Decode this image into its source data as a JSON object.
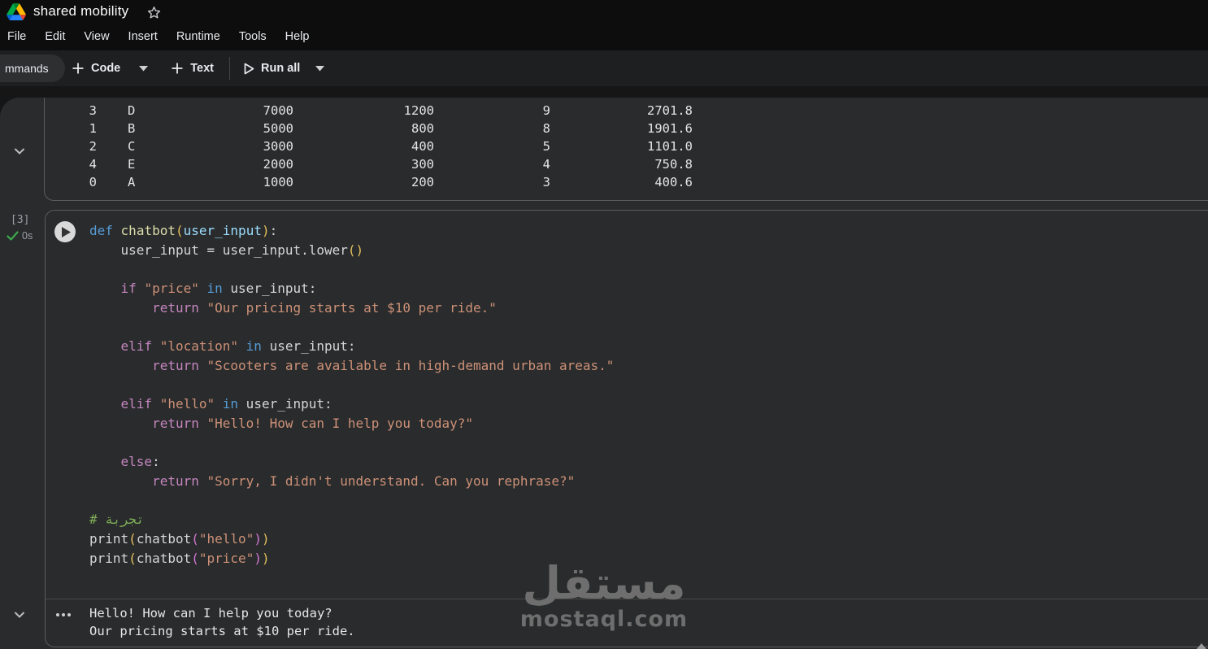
{
  "titlebar": {
    "title": "shared mobility"
  },
  "menubar": {
    "items": [
      "File",
      "Edit",
      "View",
      "Insert",
      "Runtime",
      "Tools",
      "Help"
    ]
  },
  "toolbar": {
    "commands_label": "mmands",
    "code_label": "Code",
    "text_label": "Text",
    "run_all_label": "Run all"
  },
  "table_output": {
    "rows": [
      [
        "3",
        "D",
        "7000",
        "1200",
        "9",
        "2701.8"
      ],
      [
        "1",
        "B",
        "5000",
        "800",
        "8",
        "1901.6"
      ],
      [
        "2",
        "C",
        "3000",
        "400",
        "5",
        "1101.0"
      ],
      [
        "4",
        "E",
        "2000",
        "300",
        "4",
        "750.8"
      ],
      [
        "0",
        "A",
        "1000",
        "200",
        "3",
        "400.6"
      ]
    ]
  },
  "code_cell": {
    "execution_count": "[3]",
    "execution_time": "0s",
    "lines": [
      [
        [
          "kw",
          "def"
        ],
        [
          "pl",
          " "
        ],
        [
          "fn",
          "chatbot"
        ],
        [
          "b1",
          "("
        ],
        [
          "var",
          "user_input"
        ],
        [
          "b1",
          ")"
        ],
        [
          "pl",
          ":"
        ]
      ],
      [
        [
          "pl",
          "    user_input = user_input.lower"
        ],
        [
          "b1",
          "()"
        ]
      ],
      [],
      [
        [
          "pl",
          "    "
        ],
        [
          "ctl",
          "if"
        ],
        [
          "pl",
          " "
        ],
        [
          "str",
          "\"price\""
        ],
        [
          "pl",
          " "
        ],
        [
          "kw",
          "in"
        ],
        [
          "pl",
          " user_input:"
        ]
      ],
      [
        [
          "pl",
          "        "
        ],
        [
          "ctl",
          "return"
        ],
        [
          "pl",
          " "
        ],
        [
          "str",
          "\"Our pricing starts at $10 per ride.\""
        ]
      ],
      [],
      [
        [
          "pl",
          "    "
        ],
        [
          "ctl",
          "elif"
        ],
        [
          "pl",
          " "
        ],
        [
          "str",
          "\"location\""
        ],
        [
          "pl",
          " "
        ],
        [
          "kw",
          "in"
        ],
        [
          "pl",
          " user_input:"
        ]
      ],
      [
        [
          "pl",
          "        "
        ],
        [
          "ctl",
          "return"
        ],
        [
          "pl",
          " "
        ],
        [
          "str",
          "\"Scooters are available in high-demand urban areas.\""
        ]
      ],
      [],
      [
        [
          "pl",
          "    "
        ],
        [
          "ctl",
          "elif"
        ],
        [
          "pl",
          " "
        ],
        [
          "str",
          "\"hello\""
        ],
        [
          "pl",
          " "
        ],
        [
          "kw",
          "in"
        ],
        [
          "pl",
          " user_input:"
        ]
      ],
      [
        [
          "pl",
          "        "
        ],
        [
          "ctl",
          "return"
        ],
        [
          "pl",
          " "
        ],
        [
          "str",
          "\"Hello! How can I help you today?\""
        ]
      ],
      [],
      [
        [
          "pl",
          "    "
        ],
        [
          "ctl",
          "else"
        ],
        [
          "pl",
          ":"
        ]
      ],
      [
        [
          "pl",
          "        "
        ],
        [
          "ctl",
          "return"
        ],
        [
          "pl",
          " "
        ],
        [
          "str",
          "\"Sorry, I didn't understand. Can you rephrase?\""
        ]
      ],
      [],
      [
        [
          "cmt",
          "# تجربة"
        ]
      ],
      [
        [
          "pl",
          "print"
        ],
        [
          "b1",
          "("
        ],
        [
          "pl",
          "chatbot"
        ],
        [
          "b2",
          "("
        ],
        [
          "str",
          "\"hello\""
        ],
        [
          "b2",
          ")"
        ],
        [
          "b1",
          ")"
        ]
      ],
      [
        [
          "pl",
          "print"
        ],
        [
          "b1",
          "("
        ],
        [
          "pl",
          "chatbot"
        ],
        [
          "b2",
          "("
        ],
        [
          "str",
          "\"price\""
        ],
        [
          "b2",
          ")"
        ],
        [
          "b1",
          ")"
        ]
      ]
    ]
  },
  "cell_output": {
    "lines": [
      "Hello! How can I help you today?",
      "Our pricing starts at $10 per ride."
    ]
  },
  "watermark": {
    "logo": "مستقل",
    "domain": "mostaql.com"
  },
  "colors": {
    "chrome_bg": "#0d0d0e",
    "toolbar_bg": "#1e1f20",
    "panel_bg": "#292b2c",
    "cell_border": "#5c5c5c",
    "keyword_blue": "#569cd6",
    "control_pink": "#c586c0",
    "function_yellow": "#dcdcaa",
    "param_blue": "#9cdcfe",
    "string_orange": "#ce9178",
    "comment_green": "#7fae58",
    "bracket_gold": "#e3bf5e",
    "bracket_pink": "#d277d2",
    "check_green": "#3dab4e",
    "gutter_gray": "#9aa0a6",
    "watermark_gray": "#6e6e6e"
  }
}
